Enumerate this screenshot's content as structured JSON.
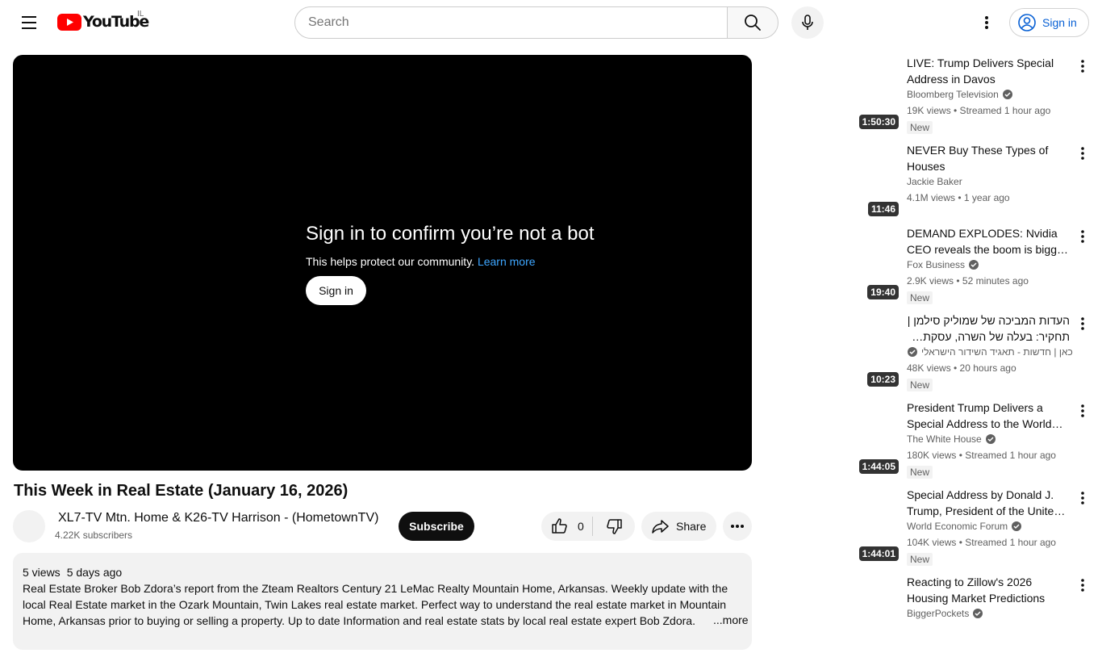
{
  "header": {
    "logo_text": "YouTube",
    "country_code": "IL",
    "search_placeholder": "Search",
    "signin_label": "Sign in"
  },
  "player": {
    "bot_title": "Sign in to confirm you’re not a bot",
    "bot_desc": "This helps protect our community.",
    "learn_more": "Learn more",
    "signin_label": "Sign in"
  },
  "video": {
    "title": "This Week in Real Estate (January 16, 2026)",
    "channel_name": "XL7-TV Mtn. Home & K26-TV Harrison - (HometownTV)",
    "subscribers": "4.22K subscribers",
    "subscribe_label": "Subscribe",
    "like_count": "0",
    "share_label": "Share"
  },
  "description": {
    "views": "5 views",
    "date": "5 days ago",
    "text": "Real Estate Broker Bob Zdora’s report from the Zteam Realtors Century 21 LeMac Realty Mountain Home, Arkansas. Weekly update with the local Real Estate market in the Ozark Mountain, Twin Lakes real estate market. Perfect way to understand the real estate market in Mountain Home, Arkansas prior to buying or selling a property. Up to date Information and real estate stats by local real estate expert Bob Zdora.",
    "more_label": "...more"
  },
  "recommendations": [
    {
      "title": "LIVE: Trump Delivers Special Address in Davos",
      "channel": "Bloomberg Television",
      "verified": true,
      "meta": "19K views • Streamed 1 hour ago",
      "badge": "New",
      "duration": "1:50:30",
      "rtl": false
    },
    {
      "title": "NEVER Buy These Types of Houses",
      "channel": "Jackie Baker",
      "verified": false,
      "meta": "4.1M views • 1 year ago",
      "badge": "",
      "duration": "11:46",
      "rtl": false
    },
    {
      "title": "DEMAND EXPLODES: Nvidia CEO reveals the boom is bigger than expected",
      "channel": "Fox Business",
      "verified": true,
      "meta": "2.9K views • 52 minutes ago",
      "badge": "New",
      "duration": "19:40",
      "rtl": false
    },
    {
      "title": "העדות המביכה של שמוליק סילמן | תחקיר: בעלה של השרה, עסקת הדירה ויועצי התקשורת",
      "channel": "כאן | חדשות - תאגיד השידור הישראלי",
      "verified": true,
      "meta": "48K views • 20 hours ago",
      "badge": "New",
      "duration": "10:23",
      "rtl": true
    },
    {
      "title": "President Trump Delivers a Special Address to the World Economic Forum",
      "channel": "The White House",
      "verified": true,
      "meta": "180K views • Streamed 1 hour ago",
      "badge": "New",
      "duration": "1:44:05",
      "rtl": false
    },
    {
      "title": "Special Address by Donald J. Trump, President of the United States of America",
      "channel": "World Economic Forum",
      "verified": true,
      "meta": "104K views • Streamed 1 hour ago",
      "badge": "New",
      "duration": "1:44:01",
      "rtl": false
    },
    {
      "title": "Reacting to Zillow's 2026 Housing Market Predictions",
      "channel": "BiggerPockets",
      "verified": true,
      "meta": "",
      "badge": "",
      "duration": "",
      "rtl": false
    }
  ]
}
